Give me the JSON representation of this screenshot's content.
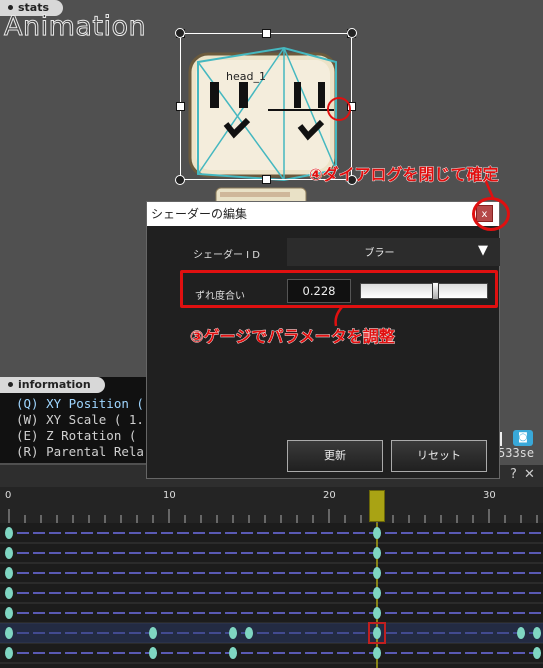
{
  "preview": {
    "stats_tab": "stats",
    "mode_title": "Animation",
    "bone_label": "head_1",
    "info_tab": "information",
    "info_lines": [
      "(Q) XY Position (",
      "(W) XY Scale ( 1.",
      "(E) Z Rotation (",
      "(R) Parental Rela"
    ],
    "right_status": "533se"
  },
  "dialog": {
    "title": "シェーダーの編集",
    "close_label": "x",
    "shader_id_label": "シェーダー I D",
    "shader_id_value": "ブラー",
    "shift_label": "ずれ度合い",
    "shift_value": "0.228",
    "shift_level": 0.6,
    "update_button": "更新",
    "reset_button": "リセット"
  },
  "annotations": {
    "gauge_note": "③ゲージでパラメータを調整",
    "close_note": "④ダイアログを閉じて確定"
  },
  "timeline": {
    "help_label": "?",
    "close_label": "✕",
    "ruler_labels": [
      "0",
      "10",
      "20",
      "30"
    ],
    "current_frame": 23
  },
  "colors": {
    "annotation_red": "#e01010",
    "playhead": "#a9a314",
    "keyframe": "#7fd6c2",
    "track_line": "#5a5ab4"
  }
}
